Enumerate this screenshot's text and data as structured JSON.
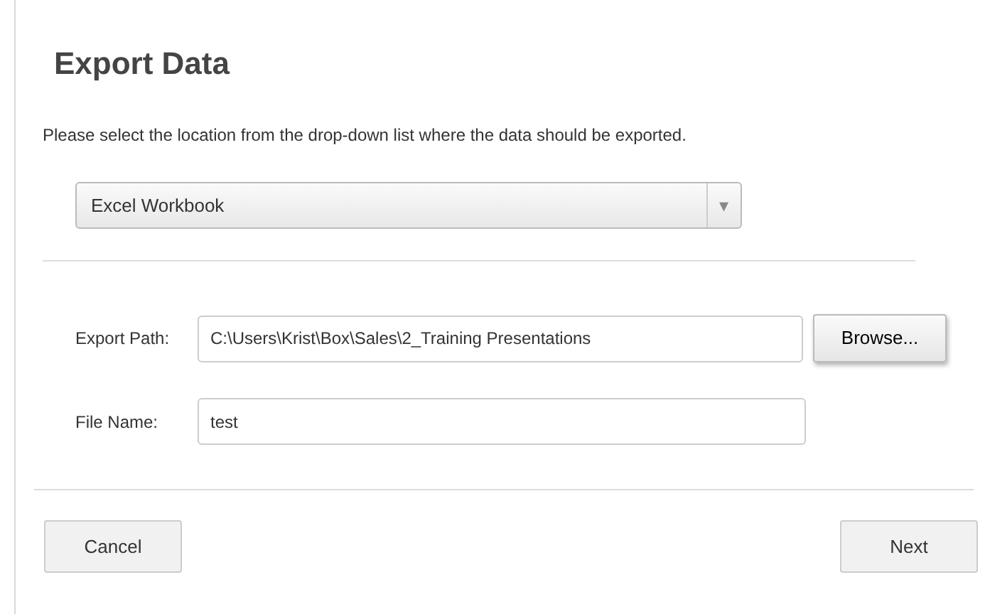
{
  "dialog": {
    "title": "Export Data"
  },
  "instruction": "Please select the location from the drop-down list where the data should be exported.",
  "destination": {
    "value": "Excel Workbook",
    "arrow": "▾"
  },
  "fields": [
    {
      "label": "Export Path:",
      "value": "C:\\Users\\Krist\\Box\\Sales\\2_Training Presentations",
      "button": "Browse..."
    },
    {
      "label": "File Name:",
      "value": "test"
    }
  ],
  "buttons": [
    "Cancel",
    "Next"
  ]
}
